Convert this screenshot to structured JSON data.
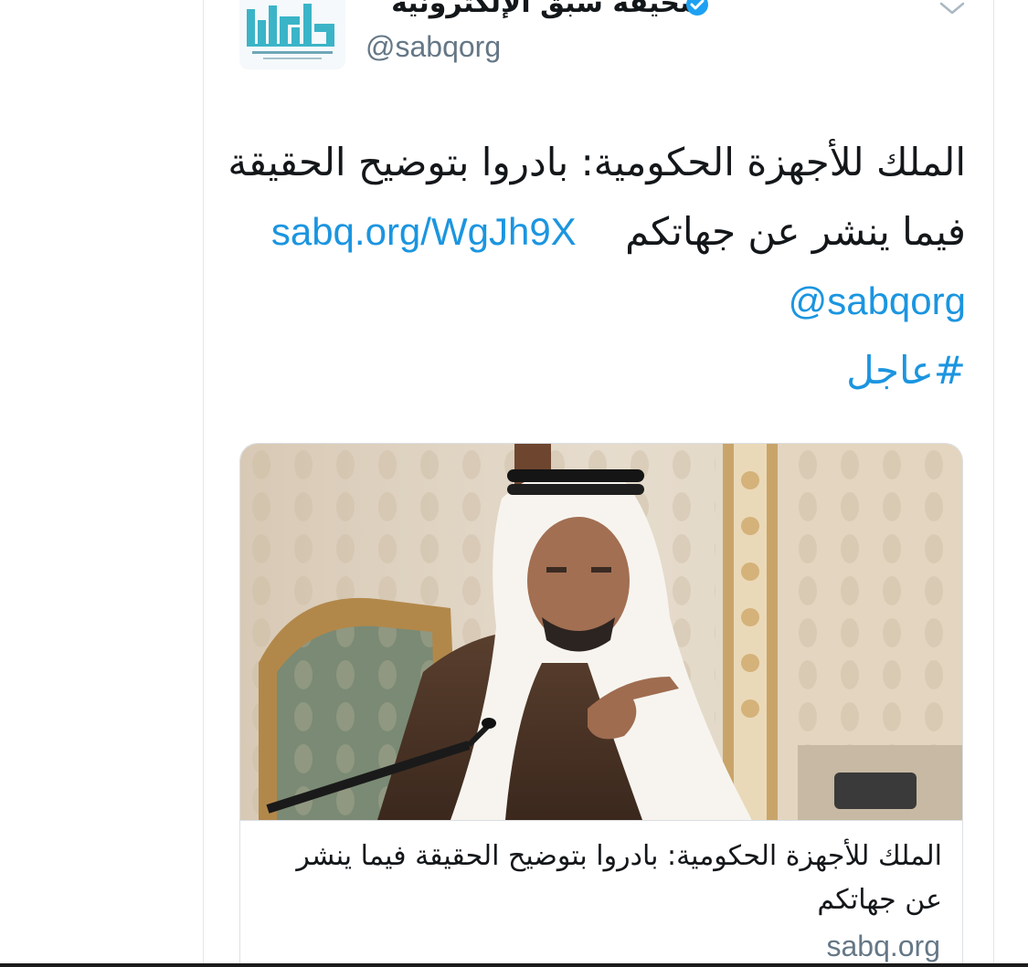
{
  "tweet": {
    "author_name": "صحيفة سبق الإلكترونية",
    "handle": "@sabqorg",
    "text_line1": "الملك للأجهزة الحكومية: بادروا بتوضيح الحقيقة",
    "text_line2_words": "فيما ينشر عن جهاتكم",
    "link": "sabq.org/WgJh9X",
    "mention": "@sabqorg",
    "hashtag": "#عاجل"
  },
  "card": {
    "title": "الملك للأجهزة الحكومية: بادروا بتوضيح الحقيقة فيما ينشر عن جهاتكم",
    "domain": "sabq.org"
  },
  "icons": {
    "verified": "verified-badge-icon",
    "caret": "chevron-down-icon",
    "avatar": "sabq-logo"
  },
  "colors": {
    "link": "#1b95e0",
    "verified": "#1da1f2",
    "text": "#14171a",
    "muted": "#657786",
    "logo": "#3bb4c8"
  }
}
